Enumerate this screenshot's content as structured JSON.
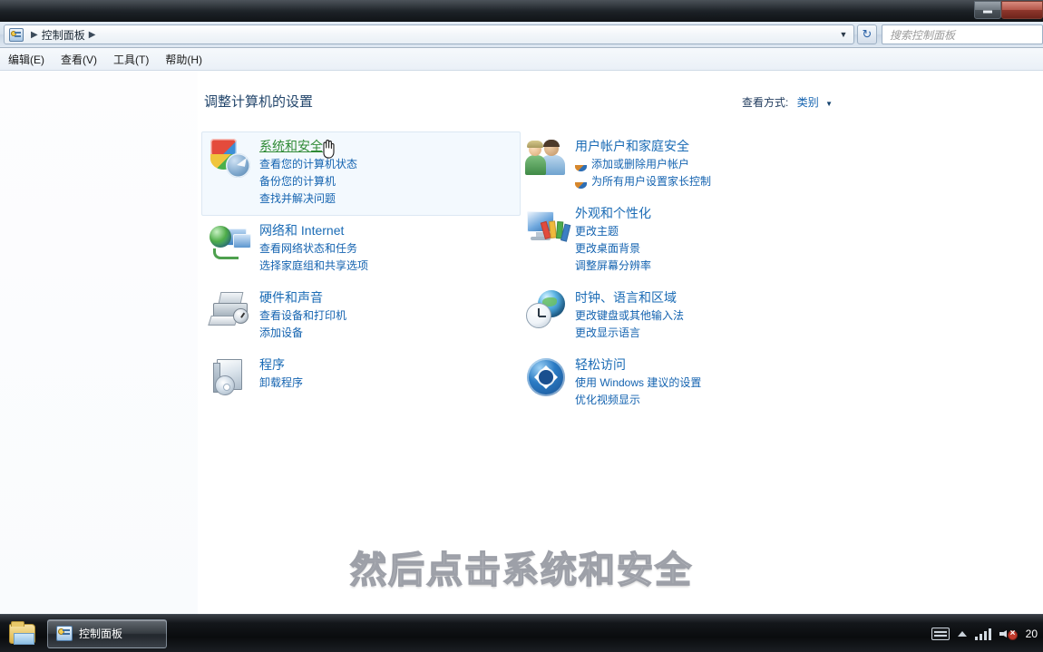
{
  "window": {
    "titlebar_buttons": [
      {
        "name": "minimize",
        "glyph": "–"
      },
      {
        "name": "maximize",
        "glyph": "❐"
      }
    ],
    "address": {
      "icon": "control-panel-icon",
      "crumbs": [
        "控制面板"
      ],
      "separator": "▶",
      "dropdown_caret": "▼",
      "refresh_glyph": "↻"
    },
    "search": {
      "placeholder": "搜索控制面板",
      "value": ""
    },
    "menubar": [
      "编辑(E)",
      "查看(V)",
      "工具(T)",
      "帮助(H)"
    ]
  },
  "content": {
    "page_title": "调整计算机的设置",
    "view_by_label": "查看方式:",
    "view_by_value": "类别",
    "view_by_caret": "▼",
    "categories_left": [
      {
        "icon": "system-security-icon",
        "title": "系统和安全",
        "hovered": true,
        "links": [
          {
            "text": "查看您的计算机状态",
            "shield": false
          },
          {
            "text": "备份您的计算机",
            "shield": false
          },
          {
            "text": "查找并解决问题",
            "shield": false
          }
        ]
      },
      {
        "icon": "network-internet-icon",
        "title": "网络和 Internet",
        "hovered": false,
        "links": [
          {
            "text": "查看网络状态和任务",
            "shield": false
          },
          {
            "text": "选择家庭组和共享选项",
            "shield": false
          }
        ]
      },
      {
        "icon": "hardware-sound-icon",
        "title": "硬件和声音",
        "hovered": false,
        "links": [
          {
            "text": "查看设备和打印机",
            "shield": false
          },
          {
            "text": "添加设备",
            "shield": false
          }
        ]
      },
      {
        "icon": "programs-icon",
        "title": "程序",
        "hovered": false,
        "links": [
          {
            "text": "卸载程序",
            "shield": false
          }
        ]
      }
    ],
    "categories_right": [
      {
        "icon": "user-accounts-icon",
        "title": "用户帐户和家庭安全",
        "hovered": false,
        "links": [
          {
            "text": "添加或删除用户帐户",
            "shield": true
          },
          {
            "text": "为所有用户设置家长控制",
            "shield": true
          }
        ]
      },
      {
        "icon": "appearance-personalization-icon",
        "title": "外观和个性化",
        "hovered": false,
        "links": [
          {
            "text": "更改主题",
            "shield": false
          },
          {
            "text": "更改桌面背景",
            "shield": false
          },
          {
            "text": "调整屏幕分辨率",
            "shield": false
          }
        ]
      },
      {
        "icon": "clock-language-region-icon",
        "title": "时钟、语言和区域",
        "hovered": false,
        "links": [
          {
            "text": "更改键盘或其他输入法",
            "shield": false
          },
          {
            "text": "更改显示语言",
            "shield": false
          }
        ]
      },
      {
        "icon": "ease-of-access-icon",
        "title": "轻松访问",
        "hovered": false,
        "links": [
          {
            "text": "使用 Windows 建议的设置",
            "shield": false
          },
          {
            "text": "优化视频显示",
            "shield": false
          }
        ]
      }
    ]
  },
  "overlay": {
    "subtitle": "然后点击系统和安全"
  },
  "taskbar": {
    "quicklaunch": [
      {
        "name": "explorer-icon"
      }
    ],
    "buttons": [
      {
        "label": "控制面板",
        "icon": "control-panel-icon",
        "active": true
      }
    ],
    "tray_icons": [
      "keyboard-ime-icon",
      "show-hidden-icons-icon",
      "network-signal-icon",
      "volume-muted-icon"
    ],
    "clock": "20"
  },
  "colors": {
    "link_blue": "#1463b0",
    "title_blue": "#1a6bb5",
    "hover_green": "#2f8a34",
    "page_title": "#22456b",
    "hover_bg": "#f3f9fe"
  }
}
